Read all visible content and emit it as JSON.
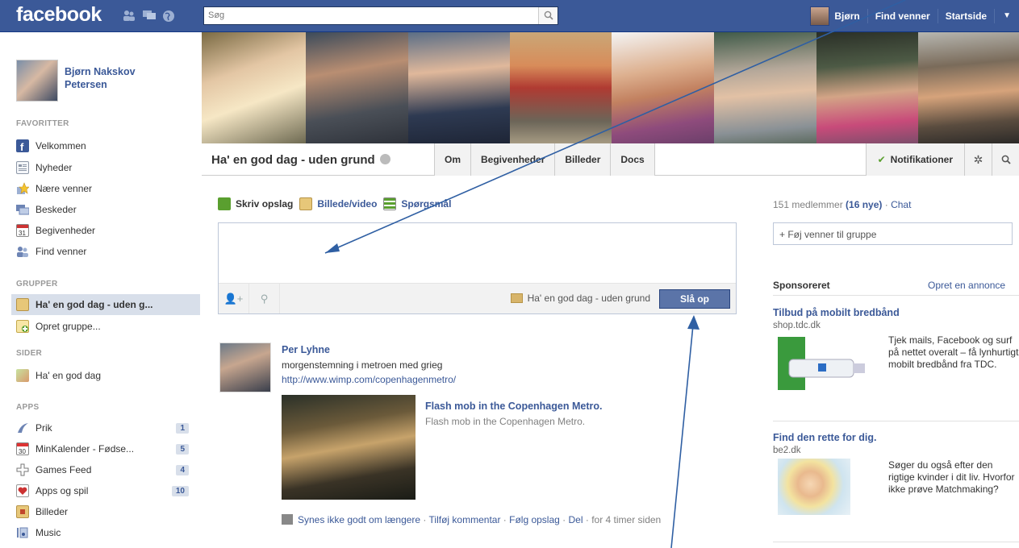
{
  "topbar": {
    "logo": "facebook",
    "search_placeholder": "Søg",
    "user_short": "Bjørn",
    "find_friends": "Find venner",
    "home": "Startside"
  },
  "sidebar": {
    "profile_name": "Bjørn Nakskov Petersen",
    "sections": {
      "favorites": "FAVORITTER",
      "groups": "GRUPPER",
      "pages": "SIDER",
      "apps": "APPS"
    },
    "favorites": [
      {
        "label": "Velkommen",
        "icon": "facebook-f-icon"
      },
      {
        "label": "Nyheder",
        "icon": "news-feed-icon"
      },
      {
        "label": "Nære venner",
        "icon": "star-icon"
      },
      {
        "label": "Beskeder",
        "icon": "messages-icon"
      },
      {
        "label": "Begivenheder",
        "icon": "calendar-icon"
      },
      {
        "label": "Find venner",
        "icon": "friends-icon"
      }
    ],
    "groups": [
      {
        "label": "Ha' en god dag - uden g...",
        "icon": "group-icon",
        "active": true
      },
      {
        "label": "Opret gruppe...",
        "icon": "create-group-icon"
      }
    ],
    "pages": [
      {
        "label": "Ha' en god dag",
        "icon": "page-icon"
      }
    ],
    "apps": [
      {
        "label": "Prik",
        "icon": "poke-icon",
        "count": "1"
      },
      {
        "label": "MinKalender - Fødse...",
        "icon": "calendar-30-icon",
        "count": "5"
      },
      {
        "label": "Games Feed",
        "icon": "games-icon",
        "count": "4"
      },
      {
        "label": "Apps og spil",
        "icon": "apps-icon",
        "count": "10"
      },
      {
        "label": "Billeder",
        "icon": "photos-icon"
      },
      {
        "label": "Music",
        "icon": "music-icon"
      }
    ]
  },
  "group": {
    "title": "Ha' en god dag - uden grund",
    "tabs": [
      "Om",
      "Begivenheder",
      "Billeder",
      "Docs"
    ],
    "notifications": "Notifikationer"
  },
  "composer": {
    "tabs": [
      "Skriv opslag",
      "Billede/video",
      "Spørgsmål"
    ],
    "audience": "Ha' en god dag - uden grund",
    "post_button": "Slå op"
  },
  "story": {
    "author": "Per Lyhne",
    "text": "morgenstemning i metroen med grieg",
    "link": "http://www.wimp.com/copenhagenmetro/",
    "attachment_title": "Flash mob in the Copenhagen Metro.",
    "attachment_desc": "Flash mob in the Copenhagen Metro.",
    "actions": [
      "Synes ikke godt om længere",
      "Tilføj kommentar",
      "Følg opslag",
      "Del"
    ],
    "time": "for 4 timer siden"
  },
  "right": {
    "members_count": "151 medlemmer",
    "members_new": "(16 nye)",
    "chat": "Chat",
    "add_friends": "+ Føj venner til gruppe",
    "sponsored": "Sponsoreret",
    "create_ad": "Opret en annonce",
    "ads": [
      {
        "title": "Tilbud på mobilt bredbånd",
        "url": "shop.tdc.dk",
        "text": "Tjek mails, Facebook og surf på nettet overalt – få lynhurtigt mobilt bredbånd fra TDC."
      },
      {
        "title": "Find den rette for dig.",
        "url": "be2.dk",
        "text": "Søger du også efter den rigtige kvinder i dit liv. Hvorfor ikke prøve Matchmaking?"
      }
    ]
  },
  "colors": {
    "brand": "#3b5998",
    "active_bg": "#d8dfea",
    "arrow": "#2f5fa3"
  }
}
